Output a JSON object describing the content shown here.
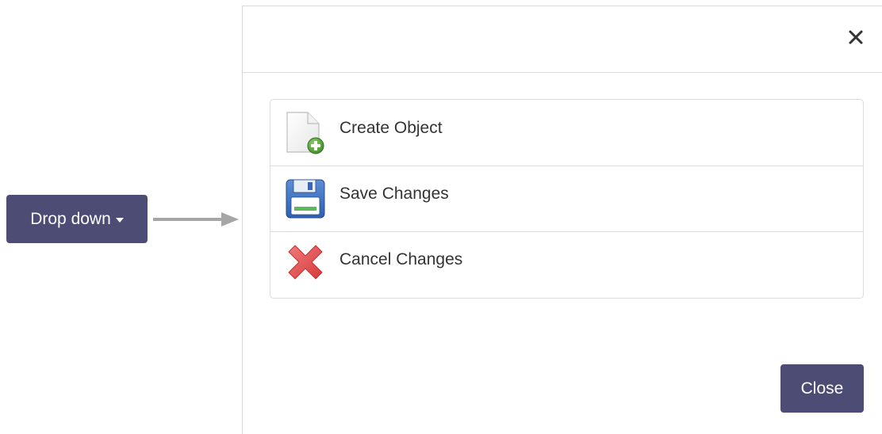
{
  "dropdown": {
    "label": "Drop down",
    "color": "#4d4c75"
  },
  "modal": {
    "close_icon": "close-icon",
    "items": [
      {
        "label": "Create Object",
        "icon": "create-object-icon"
      },
      {
        "label": "Save Changes",
        "icon": "save-icon"
      },
      {
        "label": "Cancel Changes",
        "icon": "cancel-icon"
      }
    ],
    "close_button_label": "Close"
  },
  "colors": {
    "button_bg": "#4d4c75",
    "border": "#dcdcdc",
    "text": "#333333",
    "arrow": "#a6a6a6"
  }
}
